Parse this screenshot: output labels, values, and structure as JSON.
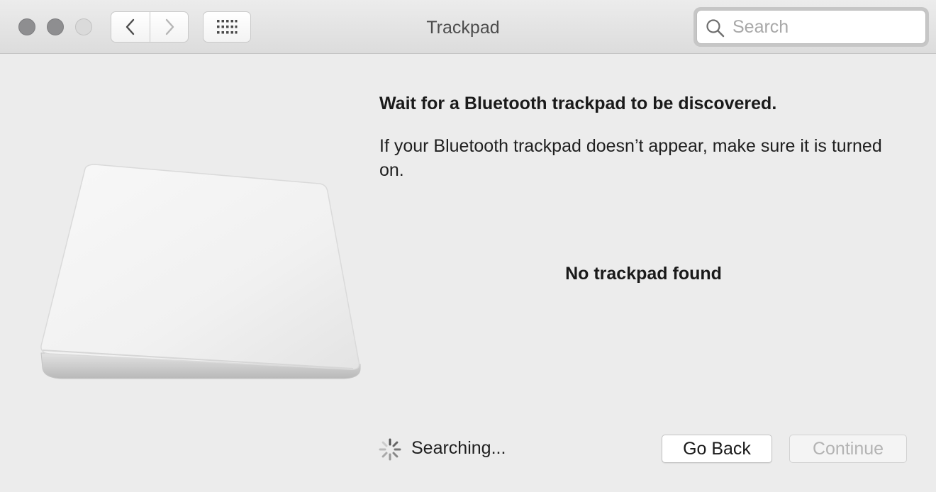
{
  "window": {
    "title": "Trackpad"
  },
  "toolbar": {
    "back_icon": "chevron-left-icon",
    "forward_icon": "chevron-right-icon",
    "grid_icon": "grid-icon"
  },
  "search": {
    "placeholder": "Search",
    "value": ""
  },
  "content": {
    "heading": "Wait for a Bluetooth trackpad to be discovered.",
    "description": "If your Bluetooth trackpad doesn’t appear, make sure it is turned on.",
    "status": "No trackpad found",
    "searching": "Searching..."
  },
  "buttons": {
    "go_back": "Go Back",
    "continue": "Continue",
    "continue_enabled": false
  },
  "colors": {
    "background": "#ececec",
    "disabled_text": "#b3b3b3"
  }
}
